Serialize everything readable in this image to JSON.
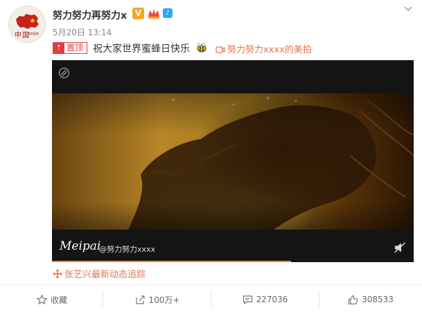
{
  "post": {
    "username": "努力努力再努力x",
    "verified_badge": "V",
    "time": "5月20日 13:14",
    "pinned_label": "置顶",
    "text": "祝大家世界蜜蜂日快乐",
    "video_link": "努力努力xxxx的美拍",
    "avatar_text": "中国",
    "avatar_subtext": "我的祖国"
  },
  "video": {
    "brand": "Meipai",
    "handle": "@努力努力xxxx",
    "progress": 0.66
  },
  "topic": {
    "label": "张艺兴最新动态追踪"
  },
  "actions": {
    "favorite": "收藏",
    "repost": "100万+",
    "comment": "227036",
    "like": "308533"
  },
  "colors": {
    "accent": "#eb7350",
    "pin_red": "#e03d3d",
    "verified": "#f5a623",
    "progress": "#f08a24"
  },
  "icons": [
    "avatar-image",
    "verified-icon",
    "crown-icon",
    "member-icon",
    "chevron-down-icon",
    "pin-icon",
    "bee-icon",
    "video-camera-icon",
    "video-logo-icon",
    "mute-icon",
    "topic-icon",
    "star-icon",
    "repost-icon",
    "comment-icon",
    "like-icon"
  ]
}
